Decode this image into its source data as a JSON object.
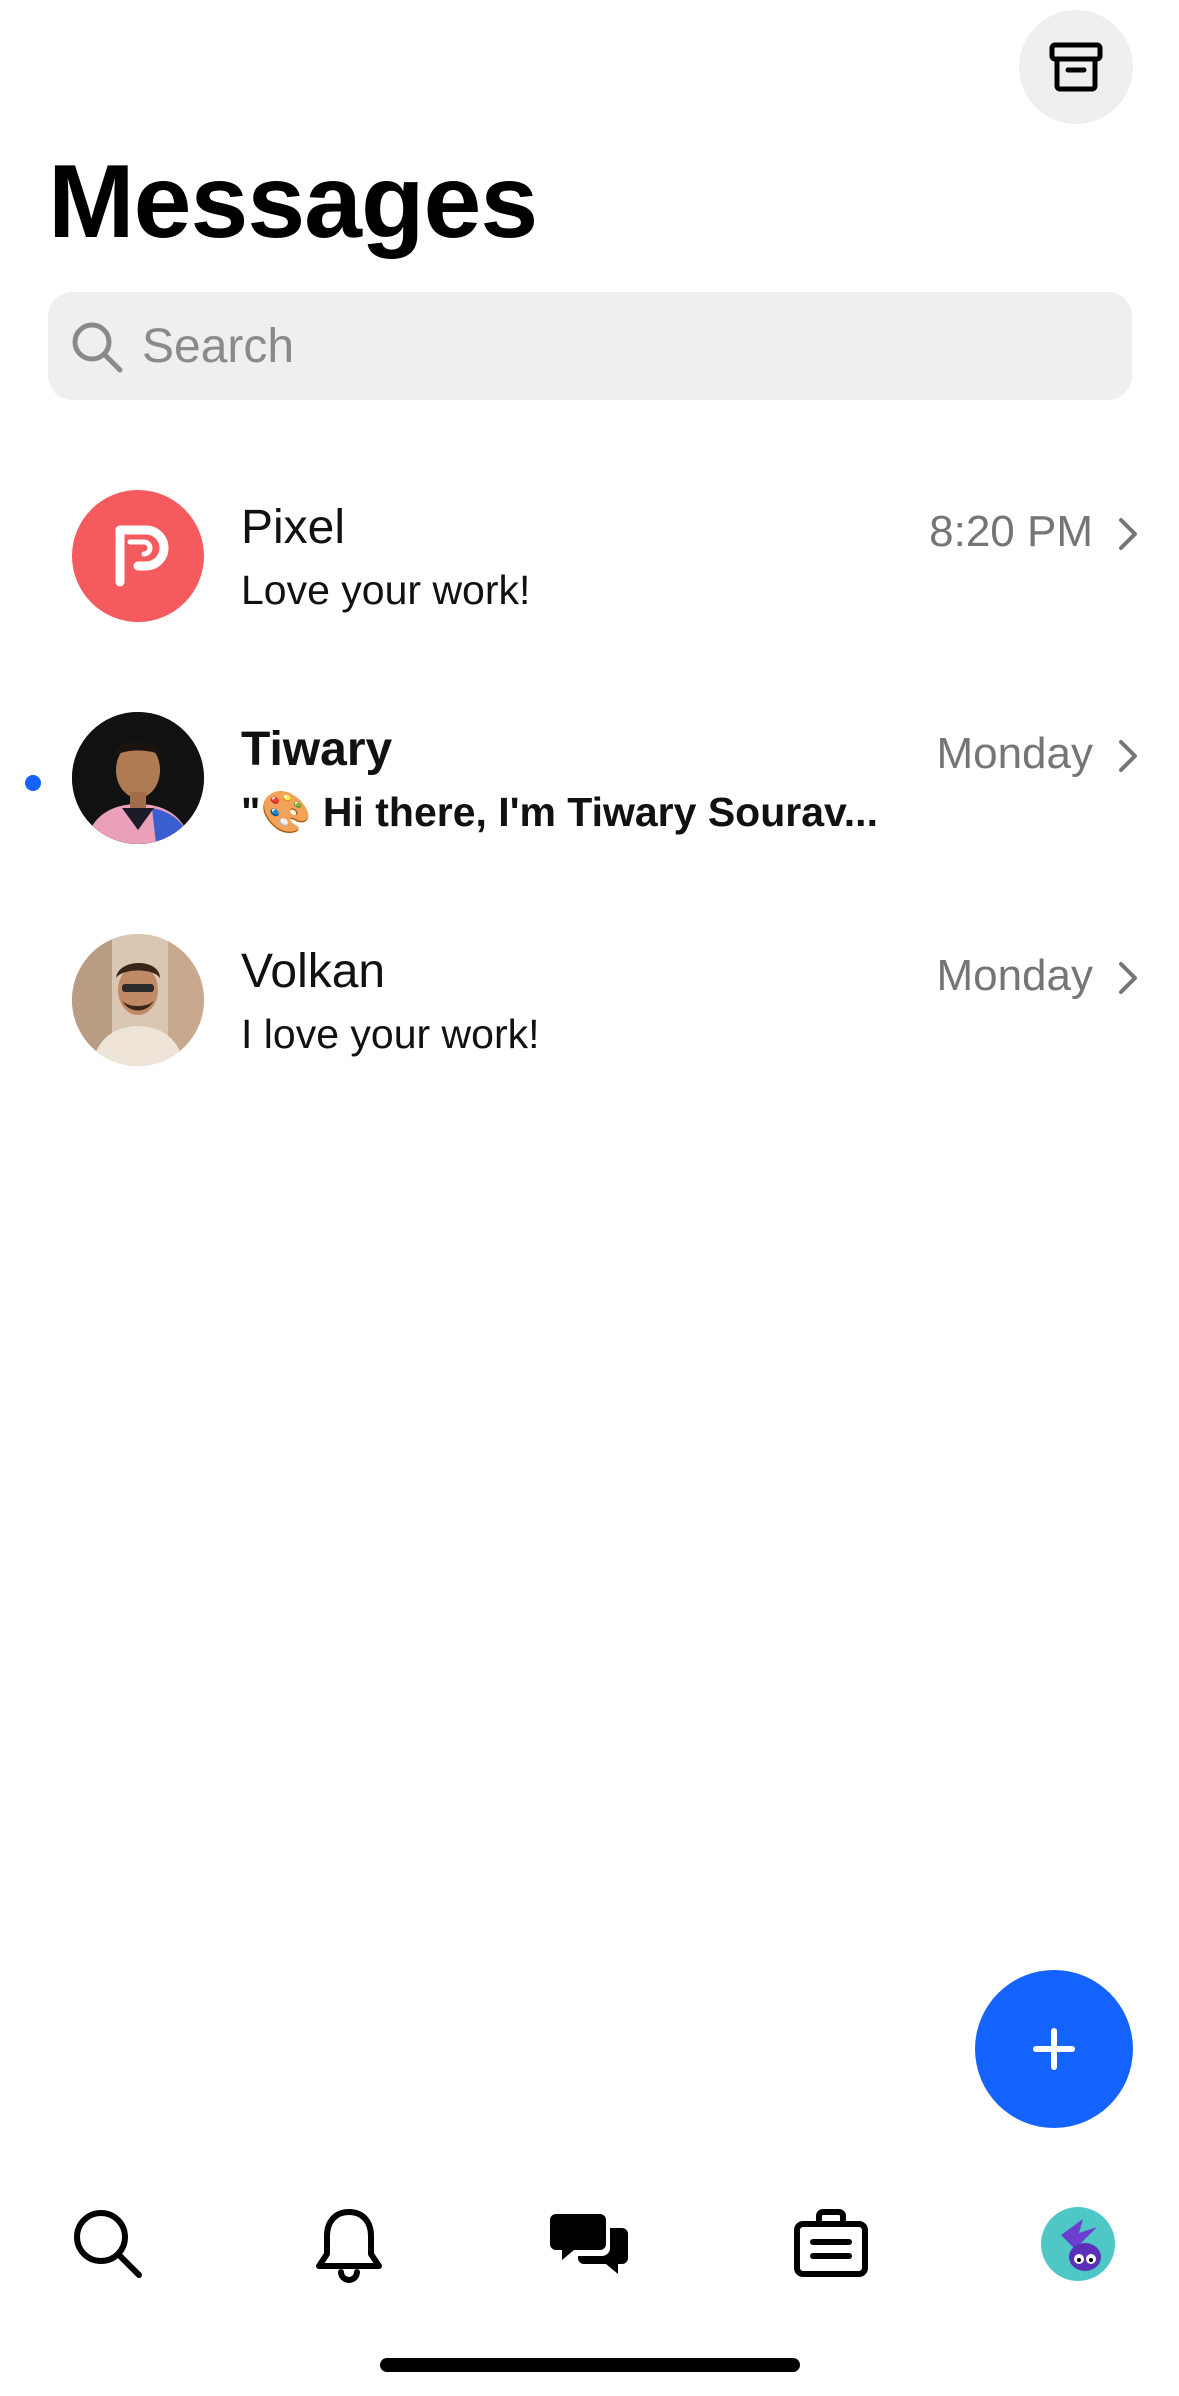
{
  "header": {
    "title": "Messages",
    "archive_icon": "archive-box-icon"
  },
  "search": {
    "placeholder": "Search",
    "value": ""
  },
  "conversations": [
    {
      "name": "Pixel",
      "time": "8:20 PM",
      "preview": "Love your work!",
      "unread": false,
      "avatar": "pixel-logo-avatar",
      "avatar_color": "#f55a5f"
    },
    {
      "name": "Tiwary",
      "time": "Monday",
      "preview": "\"🎨 Hi there, I'm Tiwary Sourav...",
      "unread": true,
      "avatar": "user-photo-avatar"
    },
    {
      "name": "Volkan",
      "time": "Monday",
      "preview": "I love your work!",
      "unread": false,
      "avatar": "user-photo-avatar"
    }
  ],
  "fab": {
    "icon": "plus-icon",
    "color": "#1463ff"
  },
  "tabbar": {
    "items": [
      {
        "name": "search",
        "icon": "search-icon",
        "active": false
      },
      {
        "name": "notifications",
        "icon": "bell-icon",
        "active": false
      },
      {
        "name": "messages",
        "icon": "chat-bubbles-icon",
        "active": true
      },
      {
        "name": "jobs",
        "icon": "briefcase-icon",
        "active": false
      },
      {
        "name": "profile",
        "icon": "profile-avatar",
        "active": false
      }
    ]
  },
  "colors": {
    "accent": "#1463ff",
    "secondary_text": "#757575",
    "search_background": "#efefef"
  }
}
